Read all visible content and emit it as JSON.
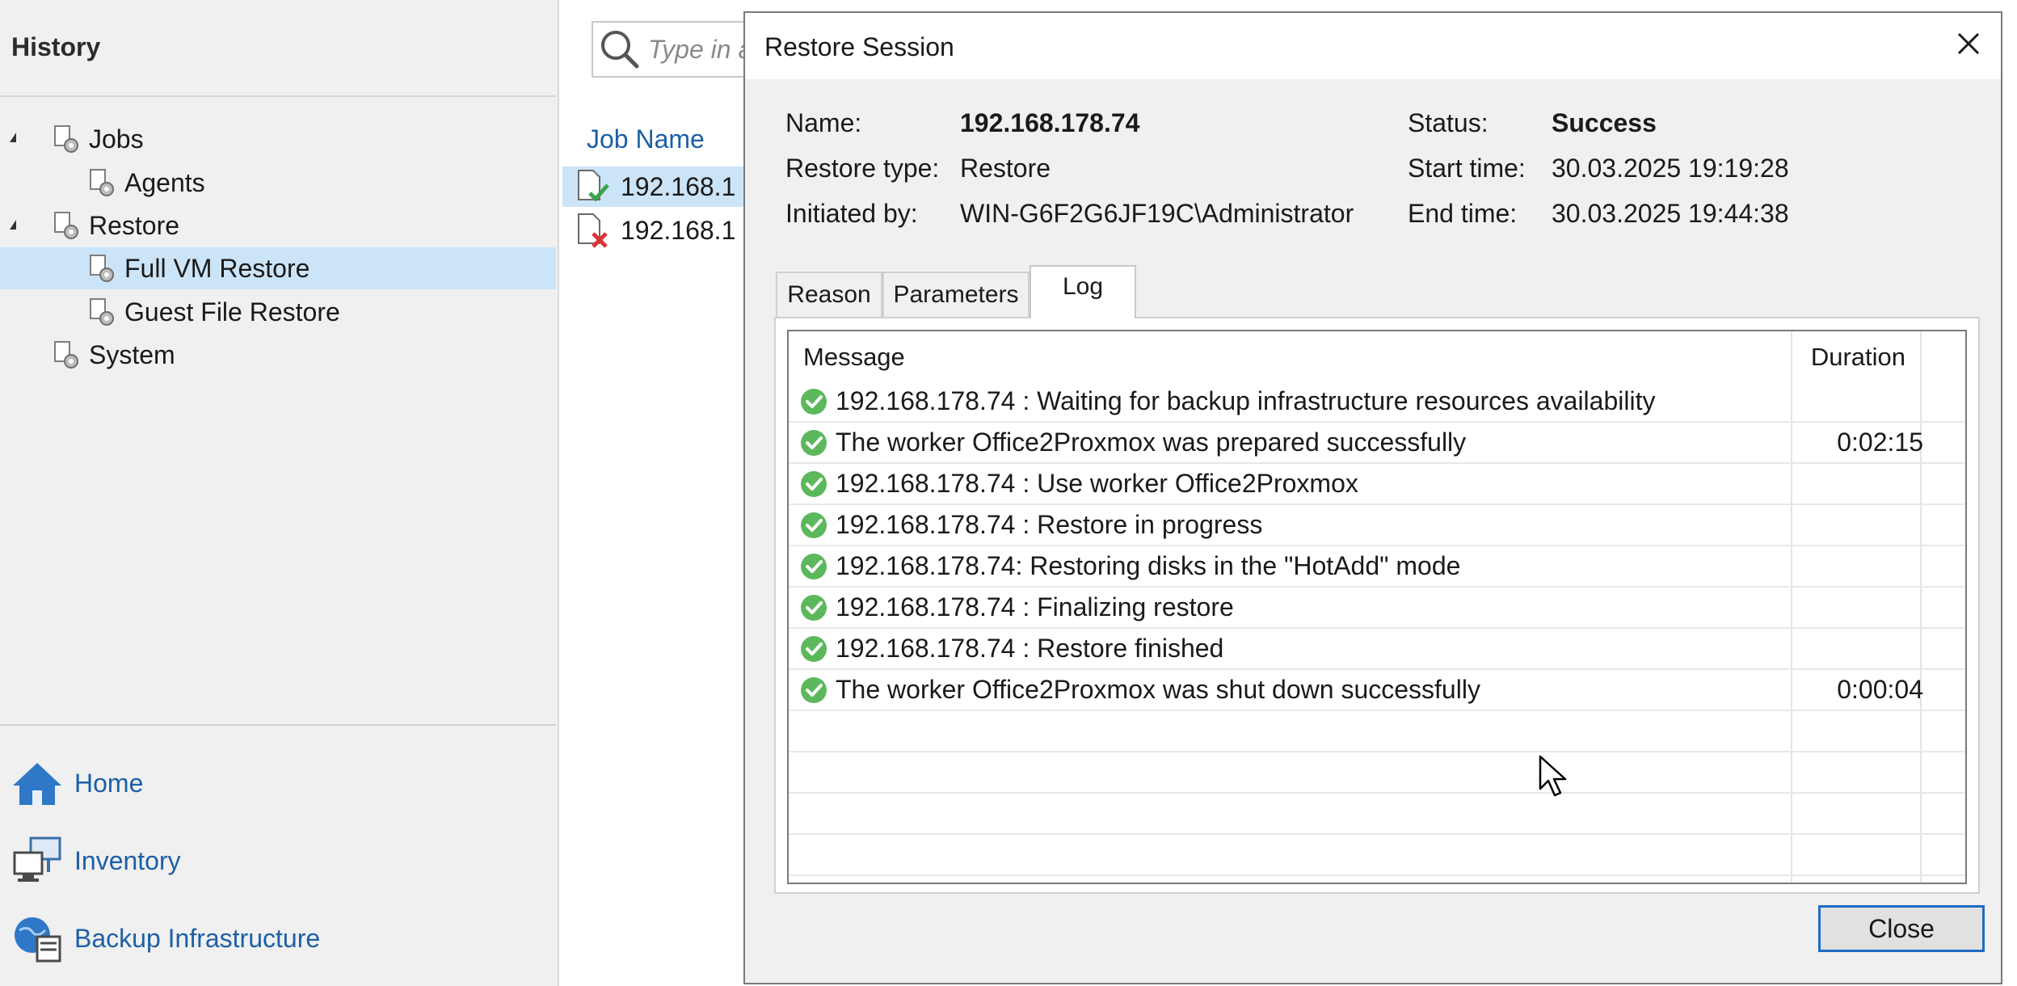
{
  "left_panel": {
    "header": "History",
    "tree": [
      {
        "label": "Jobs"
      },
      {
        "label": "Agents"
      },
      {
        "label": "Restore"
      },
      {
        "label": "Full VM Restore"
      },
      {
        "label": "Guest File Restore"
      },
      {
        "label": "System"
      }
    ],
    "nav": [
      {
        "label": "Home",
        "icon": "home-icon"
      },
      {
        "label": "Inventory",
        "icon": "inventory-icon"
      },
      {
        "label": "Backup Infrastructure",
        "icon": "backup-infrastructure-icon"
      }
    ]
  },
  "middle": {
    "search_placeholder": "Type in a",
    "column_header": "Job Name",
    "jobs": [
      {
        "name": "192.168.1",
        "status": "success"
      },
      {
        "name": "192.168.1",
        "status": "failed"
      }
    ]
  },
  "dialog": {
    "title": "Restore Session",
    "fields": {
      "name_label": "Name:",
      "name_value": "192.168.178.74",
      "restore_type_label": "Restore type:",
      "restore_type_value": "Restore",
      "initiated_by_label": "Initiated by:",
      "initiated_by_value": "WIN-G6F2G6JF19C\\Administrator",
      "status_label": "Status:",
      "status_value": "Success",
      "start_time_label": "Start time:",
      "start_time_value": "30.03.2025 19:19:28",
      "end_time_label": "End time:",
      "end_time_value": "30.03.2025 19:44:38"
    },
    "tabs": [
      "Reason",
      "Parameters",
      "Log"
    ],
    "active_tab": "Log",
    "log": {
      "headers": {
        "message": "Message",
        "duration": "Duration"
      },
      "rows": [
        {
          "message": "192.168.178.74 : Waiting for backup infrastructure resources availability",
          "duration": ""
        },
        {
          "message": "The worker Office2Proxmox was prepared successfully",
          "duration": "0:02:15"
        },
        {
          "message": "192.168.178.74 : Use worker Office2Proxmox",
          "duration": ""
        },
        {
          "message": "192.168.178.74 : Restore in progress",
          "duration": ""
        },
        {
          "message": "192.168.178.74: Restoring disks in the \"HotAdd\" mode",
          "duration": ""
        },
        {
          "message": "192.168.178.74 : Finalizing restore",
          "duration": ""
        },
        {
          "message": "192.168.178.74 : Restore finished",
          "duration": ""
        },
        {
          "message": "The worker Office2Proxmox was shut down successfully",
          "duration": "0:00:04"
        }
      ]
    },
    "close_button": "Close"
  },
  "colors": {
    "accent": "#1c5fa8",
    "selection": "#cce4f7",
    "success": "#5cb85c",
    "error": "#d9343a"
  }
}
